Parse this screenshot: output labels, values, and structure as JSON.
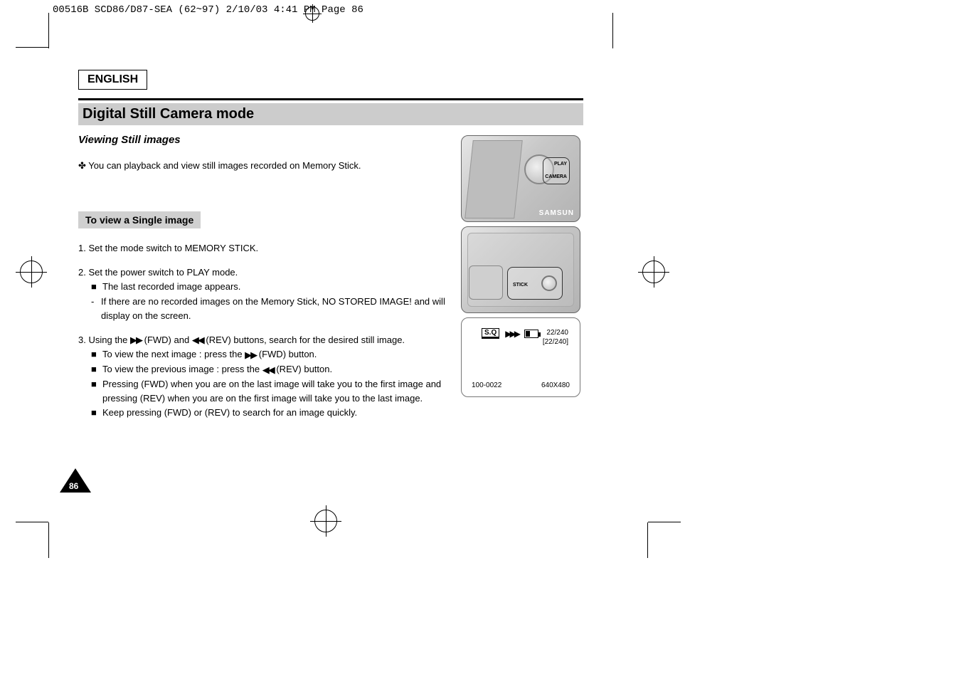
{
  "header_line": "00516B SCD86/D87-SEA (62~97)  2/10/03 4:41 PM  Page 86",
  "lang": "ENGLISH",
  "title": "Digital Still Camera mode",
  "subtitle": "Viewing Still images",
  "intro_bullet": "You can playback and view still images recorded on Memory Stick.",
  "feature": "To view a Single image",
  "steps": {
    "s1a": "Set the mode switch to MEMORY STICK.",
    "s1_num": "1.",
    "s2_num": "2.",
    "s2a": "Set the power switch to PLAY mode.",
    "s2b": "The last recorded image appears.",
    "s2c": "If there are no recorded images on the Memory Stick, NO STORED IMAGE! and        will display on the screen.",
    "s3_num": "3.",
    "s3a": "Using the       (FWD) and       (REV) buttons, search for the desired still image.",
    "s3b": "To view the next image : press the       (FWD) button.",
    "s3c": "To view the previous image : press the       (REV) button.",
    "s3d": "Pressing     (FWD) when you are on the last image will take you to the first image and pressing      (REV) when you are on the first image will take you to the last image.",
    "s3e": "Keep pressing     (FWD) or     (REV) to search for an image quickly."
  },
  "panel1": {
    "label_a": "PLAY",
    "label_b": "CAMERA",
    "brand": "SAMSUN"
  },
  "panel2": {
    "sw_label": "STICK"
  },
  "lcd": {
    "sq": "S.Q",
    "right_a": "22/240",
    "right_b": "[22/240]",
    "bottom_l": "100-0022",
    "bottom_r": "640X480"
  },
  "page_number": "86"
}
